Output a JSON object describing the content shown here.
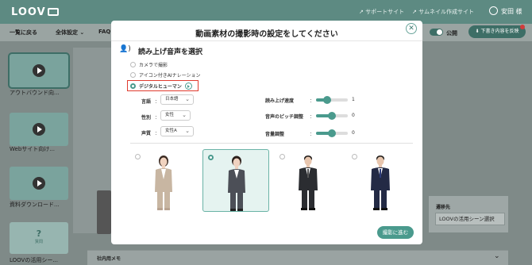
{
  "header": {
    "logo": "LOOV",
    "links": [
      "サポートサイト",
      "サムネイル作成サイト"
    ],
    "user_name": "安田 様"
  },
  "toolbar": {
    "back_label": "一覧に戻る",
    "global_settings_label": "全体設定",
    "faq_label": "FAQ",
    "public_label": "公開",
    "save_label": "下書き内容を反映"
  },
  "sidebar": {
    "items": [
      {
        "label": "アウトバウンド向..."
      },
      {
        "label": "Webサイト向け..."
      },
      {
        "label": "資料ダウンロード..."
      },
      {
        "label": "LOOVの活用シー..."
      }
    ],
    "question_mark": "?",
    "question_sub": "質問"
  },
  "destination": {
    "title": "遷移先",
    "value": "LOOVの活用シーン選択"
  },
  "memo": {
    "label": "社内用メモ"
  },
  "modal": {
    "title": "動画素材の撮影時の設定をしてください",
    "section_title": "読み上げ音声を選択",
    "options": [
      {
        "label": "カメラで撮影",
        "selected": false
      },
      {
        "label": "アイコン付きAIナレーション",
        "selected": false
      },
      {
        "label": "デジタルヒューマン",
        "selected": true
      }
    ],
    "fields": {
      "language": {
        "label": "言語",
        "value": "日本語"
      },
      "gender": {
        "label": "性別",
        "value": "女性"
      },
      "voice": {
        "label": "声質",
        "value": "女性A"
      },
      "speed": {
        "label": "読み上げ速度",
        "value": 1,
        "level": 0.35
      },
      "pitch": {
        "label": "音声のピッチ調整",
        "value": 0,
        "level": 0.5
      },
      "volume": {
        "label": "音量調整",
        "value": 0,
        "level": 0.5
      }
    },
    "avatars": [
      {
        "name": "avatar-woman-beige",
        "selected": false
      },
      {
        "name": "avatar-woman-gray",
        "selected": true
      },
      {
        "name": "avatar-man-black",
        "selected": false
      },
      {
        "name": "avatar-man-navy",
        "selected": false
      }
    ],
    "next_label": "撮影に進む",
    "close_label": "✕"
  },
  "colors": {
    "accent": "#4a9a8d",
    "highlight": "#e03b2f"
  }
}
